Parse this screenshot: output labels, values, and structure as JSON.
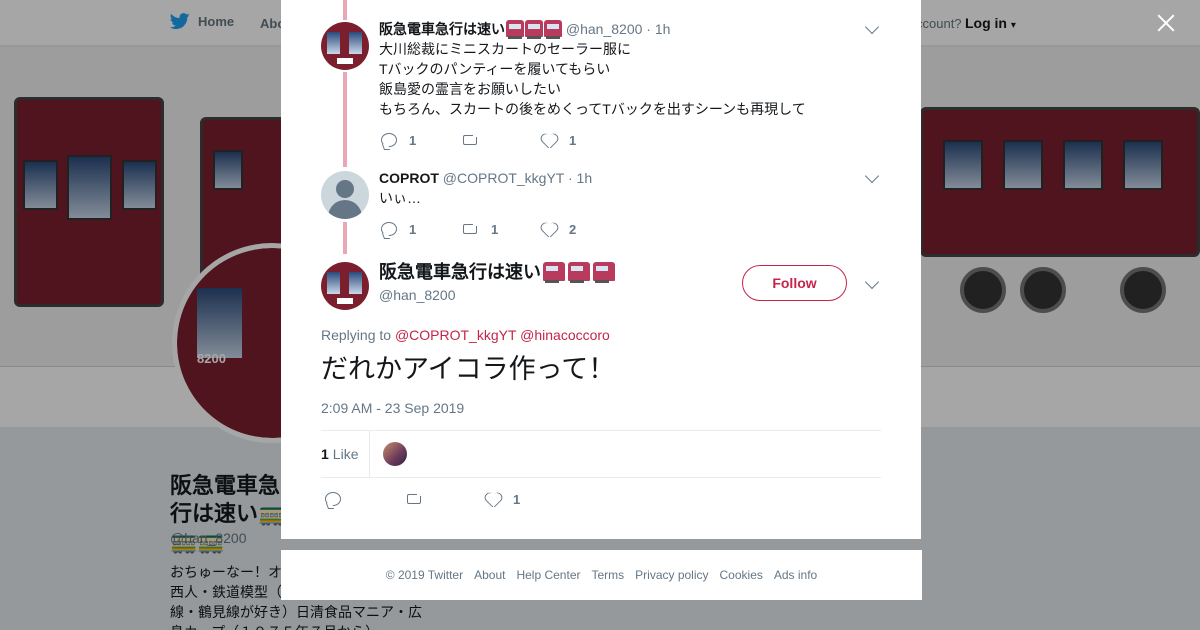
{
  "topbar": {
    "home_label": "Home",
    "about_label": "Abo",
    "account_text": "ccount?",
    "login_label": "Log in"
  },
  "profile": {
    "name": "阪急電車急行は速い🚃🚃🚃",
    "handle": "@han_8200",
    "bio": "おちゅーなー！オ\n西人・鉄道模型（\n線・鶴見線が好き）日清食品マニア・広\n島カープ（１９７５年７月から）",
    "avatar_number": "8200"
  },
  "thread": [
    {
      "name": "阪急電車急行は速い",
      "handle": "@han_8200",
      "time": "· 1h",
      "lines": [
        "大川総裁にミニスカートのセーラー服に",
        "Tバックのパンティーを履いてもらい",
        "飯島愛の霊言をお願いしたい",
        "もちろん、スカートの後をめくってTバックを出すシーンも再現して"
      ],
      "replies": "1",
      "retweets": "",
      "likes": "1"
    },
    {
      "name": "COPROT",
      "handle": "@COPROT_kkgYT",
      "time": "· 1h",
      "lines": [
        "いぃ…"
      ],
      "replies": "1",
      "retweets": "1",
      "likes": "2"
    }
  ],
  "main_tweet": {
    "name": "阪急電車急行は速い",
    "handle": "@han_8200",
    "follow_label": "Follow",
    "replying_prefix": "Replying to",
    "replying_to_1": "@COPROT_kkgYT",
    "replying_to_2": "@hinacoccoro",
    "text": "だれかアイコラ作って！",
    "datetime": "2:09 AM - 23 Sep 2019",
    "like_count": "1",
    "like_label": "Like",
    "replies": "",
    "retweets": "",
    "likes": "1"
  },
  "footer": {
    "copyright": "© 2019 Twitter",
    "about": "About",
    "help": "Help Center",
    "terms": "Terms",
    "privacy": "Privacy policy",
    "cookies": "Cookies",
    "ads": "Ads info"
  },
  "colors": {
    "accent": "#c5244b",
    "thread_line": "#e9a8b8",
    "twitter_blue": "#1da1f2"
  }
}
